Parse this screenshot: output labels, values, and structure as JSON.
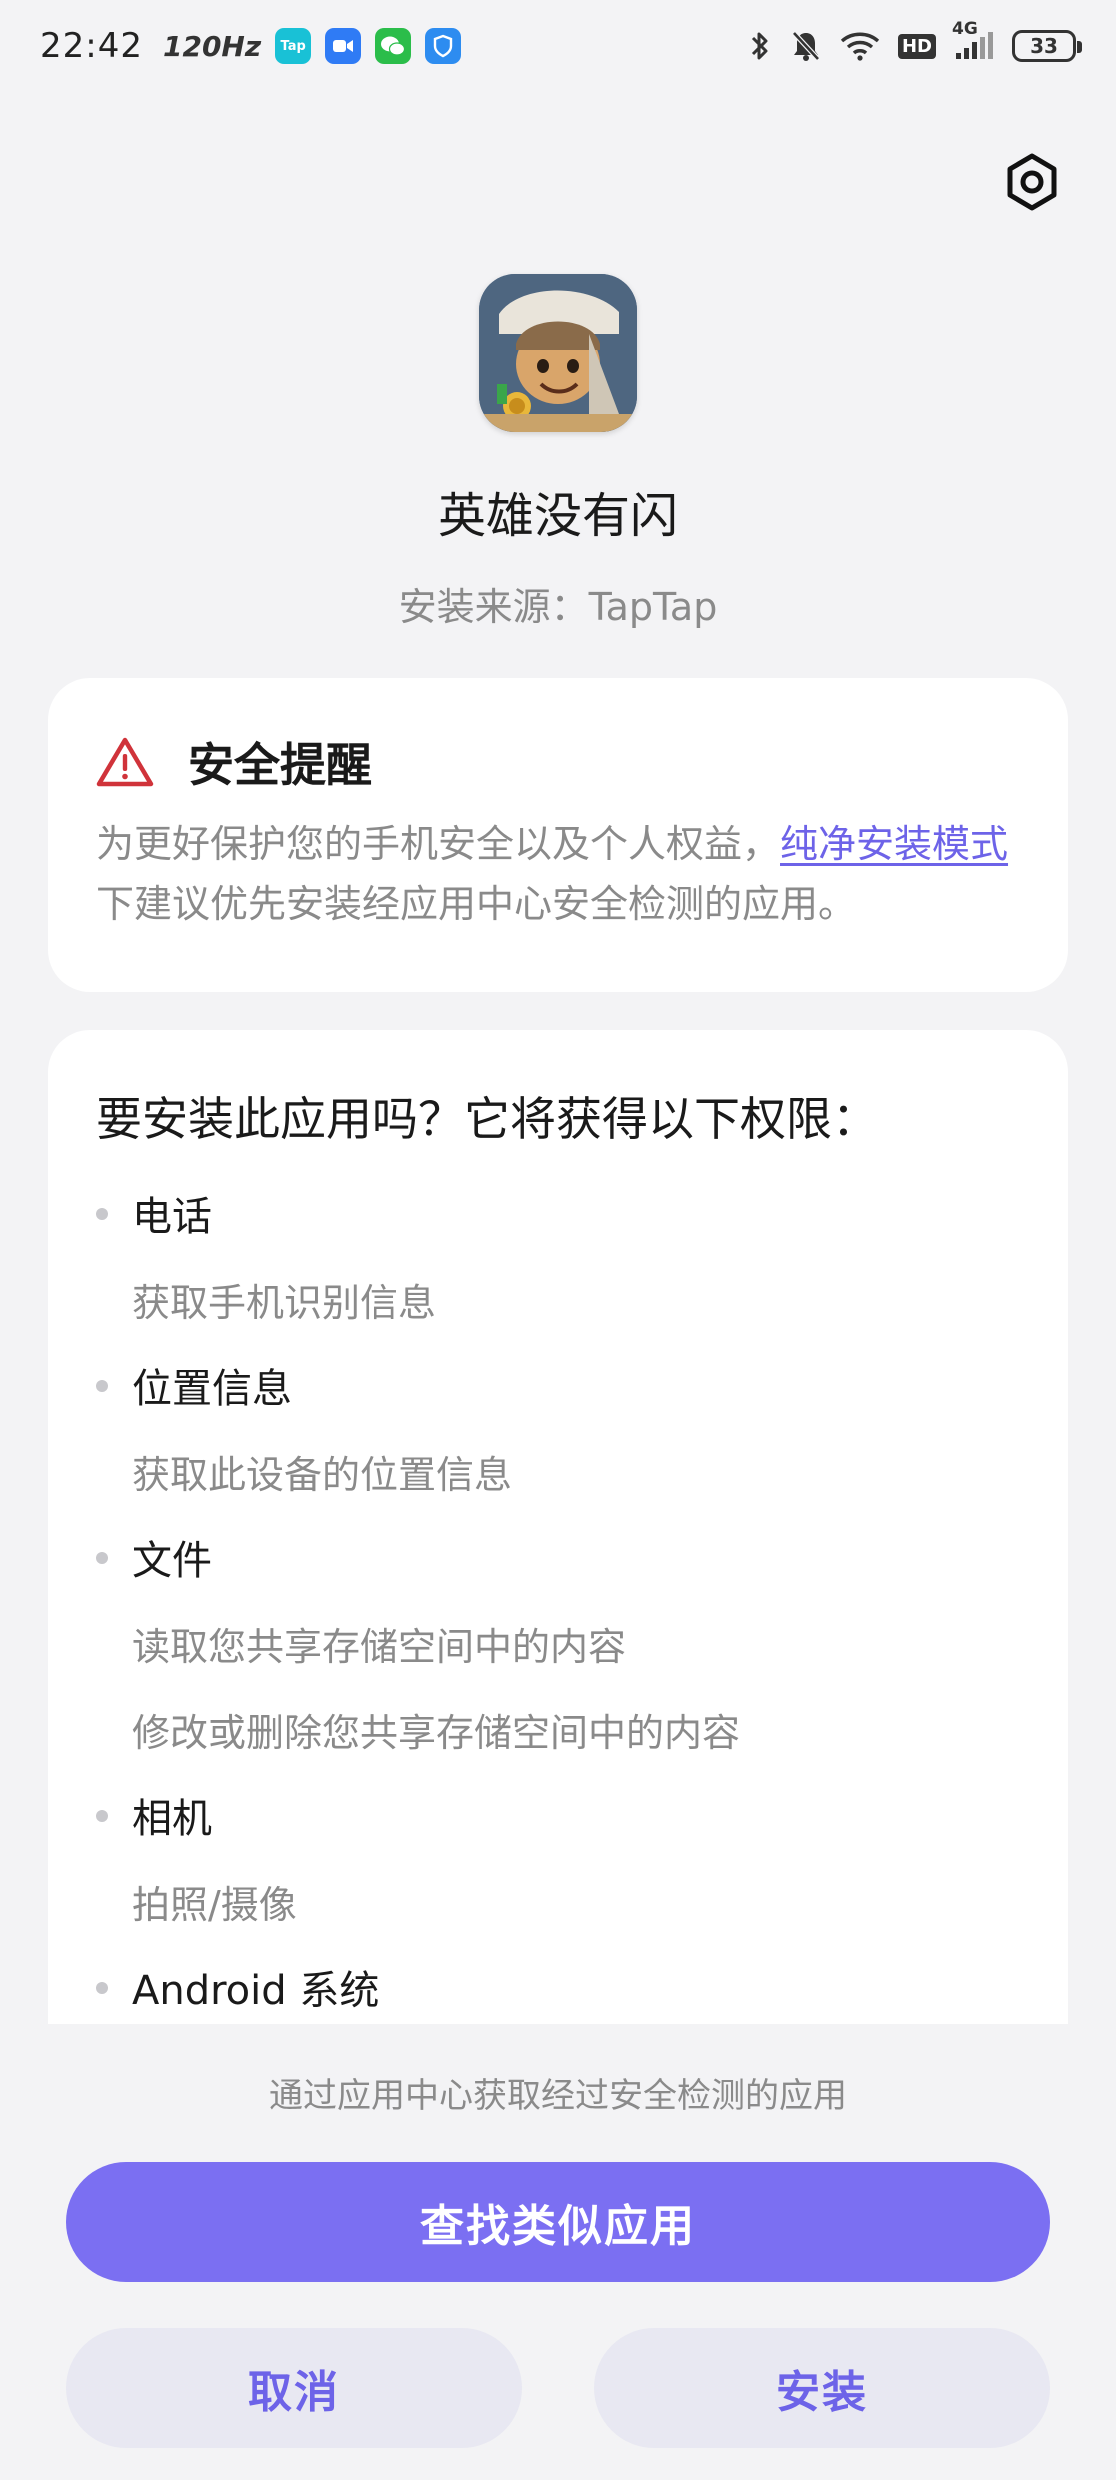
{
  "status_bar": {
    "time": "22:42",
    "refresh_rate": "120Hz",
    "app_icons": [
      {
        "name": "taptap-icon",
        "label": "Tap",
        "color": "#19c1d6"
      },
      {
        "name": "video-app-icon",
        "label": "",
        "color": "#2f7bf5"
      },
      {
        "name": "wechat-icon",
        "label": "",
        "color": "#2bbd4a"
      },
      {
        "name": "shield-app-icon",
        "label": "",
        "color": "#2d8cf0"
      }
    ],
    "network_label": "4G",
    "hd_label": "HD",
    "battery": "33"
  },
  "app": {
    "name": "英雄没有闪",
    "install_source": "安装来源：TapTap"
  },
  "security": {
    "title": "安全提醒",
    "text_before": "为更好保护您的手机安全以及个人权益，",
    "link": "纯净安装模式",
    "text_after": "下建议优先安装经应用中心安全检测的应用。",
    "warning_color": "#d0333a"
  },
  "permissions": {
    "title": "要安装此应用吗？它将获得以下权限：",
    "groups": [
      {
        "label": "电话",
        "items": [
          "获取手机识别信息"
        ]
      },
      {
        "label": "位置信息",
        "items": [
          "获取此设备的位置信息"
        ]
      },
      {
        "label": "文件",
        "items": [
          "读取您共享存储空间中的内容",
          "修改或删除您共享存储空间中的内容"
        ]
      },
      {
        "label": "相机",
        "items": [
          "拍照/摄像"
        ]
      },
      {
        "label": "Android 系统",
        "items": []
      }
    ]
  },
  "bottom": {
    "hint": "通过应用中心获取经过安全检测的应用",
    "find_similar": "查找类似应用",
    "cancel": "取消",
    "install": "安装"
  },
  "colors": {
    "accent": "#7b6ff2",
    "link": "#6d63e8",
    "secondary_button_bg": "#e8e8f2"
  }
}
